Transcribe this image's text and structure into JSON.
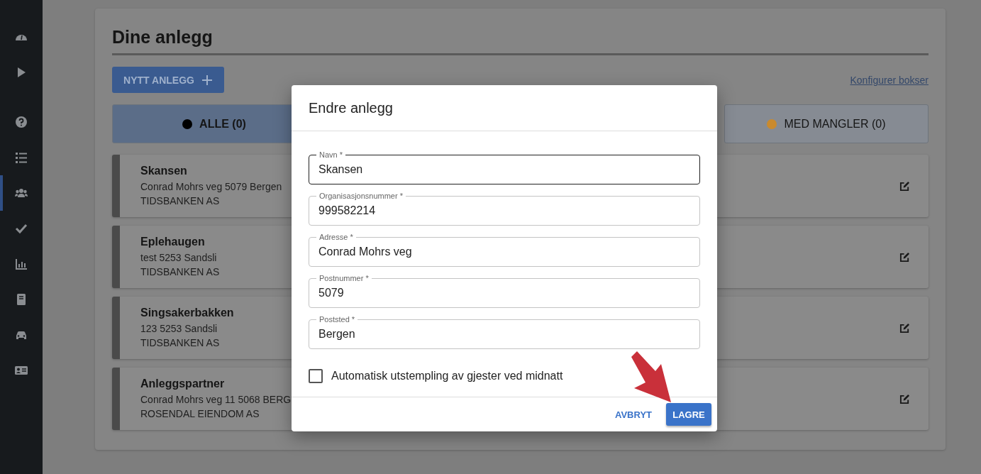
{
  "sidebar": {
    "items": [
      {
        "selected": false
      },
      {
        "selected": false
      },
      {
        "selected": false
      },
      {
        "selected": false
      },
      {
        "selected": true
      },
      {
        "selected": false
      },
      {
        "selected": false
      },
      {
        "selected": false
      },
      {
        "selected": false
      },
      {
        "selected": false
      }
    ]
  },
  "page": {
    "title": "Dine anlegg",
    "new_button": "NYTT ANLEGG",
    "configure_link": "Konfigurer bokser"
  },
  "tabs": [
    {
      "label": "ALLE (0)",
      "color": "#000000",
      "selected": true
    },
    {
      "label": "MED MANGLER (0)",
      "color": "#c98a2e",
      "selected": false
    }
  ],
  "facilities": [
    {
      "name": "Skansen",
      "address": "Conrad Mohrs veg 5079 Bergen",
      "company": "TIDSBANKEN AS"
    },
    {
      "name": "Eplehaugen",
      "address": "test 5253 Sandsli",
      "company": "TIDSBANKEN AS"
    },
    {
      "name": "Singsakerbakken",
      "address": "123 5253 Sandsli",
      "company": "TIDSBANKEN AS"
    },
    {
      "name": "Anleggspartner",
      "address": "Conrad Mohrs veg 11 5068 BERG",
      "company": "ROSENDAL EIENDOM AS"
    }
  ],
  "dialog": {
    "title": "Endre anlegg",
    "fields": [
      {
        "label": "Navn *",
        "value": "Skansen",
        "focused": true
      },
      {
        "label": "Organisasjonsnummer *",
        "value": "999582214",
        "focused": false
      },
      {
        "label": "Adresse *",
        "value": "Conrad Mohrs veg",
        "focused": false
      },
      {
        "label": "Postnummer *",
        "value": "5079",
        "focused": false
      },
      {
        "label": "Poststed *",
        "value": "Bergen",
        "focused": false
      }
    ],
    "checkbox": {
      "label": "Automatisk utstempling av gjester ved midnatt",
      "checked": false
    },
    "cancel": "AVBRYT",
    "save": "LAGRE"
  }
}
